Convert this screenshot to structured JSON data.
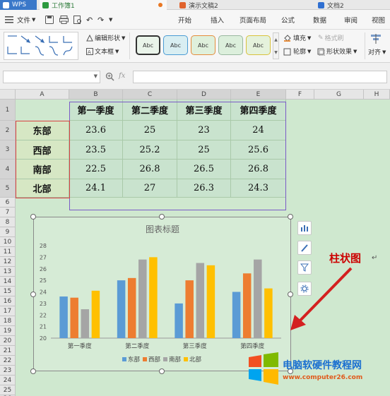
{
  "tabs": [
    {
      "label": "WPS"
    },
    {
      "label": "工作簿1"
    },
    {
      "label": "演示文稿2"
    },
    {
      "label": "文档2"
    }
  ],
  "menu": {
    "file": "文件",
    "items": [
      "开始",
      "插入",
      "页面布局",
      "公式",
      "数据",
      "审阅",
      "视图"
    ]
  },
  "ribbon": {
    "edit_shape": "编辑形状",
    "text_box": "文本框",
    "style_label": "Abc",
    "fill": "填充",
    "format_brush": "格式刷",
    "outline": "轮廓",
    "shape_effect": "形状效果",
    "align": "对齐"
  },
  "formula_bar": {
    "fx": "fx"
  },
  "columns": [
    "A",
    "B",
    "C",
    "D",
    "E",
    "F",
    "G",
    "H"
  ],
  "rows": [
    "1",
    "2",
    "3",
    "4",
    "5",
    "6",
    "7",
    "8",
    "9",
    "10",
    "11",
    "12",
    "13",
    "14",
    "15",
    "16",
    "17",
    "18",
    "19",
    "20",
    "21",
    "22",
    "23",
    "24",
    "25",
    "26"
  ],
  "table": {
    "headers": [
      "第一季度",
      "第二季度",
      "第三季度",
      "第四季度"
    ],
    "rows": [
      {
        "region": "东部",
        "values": [
          "23.6",
          "25",
          "23",
          "24"
        ]
      },
      {
        "region": "西部",
        "values": [
          "23.5",
          "25.2",
          "25",
          "25.6"
        ]
      },
      {
        "region": "南部",
        "values": [
          "22.5",
          "26.8",
          "26.5",
          "26.8"
        ]
      },
      {
        "region": "北部",
        "values": [
          "24.1",
          "27",
          "26.3",
          "24.3"
        ]
      }
    ]
  },
  "annotation": {
    "text": "柱状图",
    "color": "#cc0000"
  },
  "watermark": {
    "title": "电脑软硬件教程网",
    "url": "www.computer26.com"
  },
  "chart_data": {
    "type": "bar",
    "title": "图表标题",
    "categories": [
      "第一季度",
      "第二季度",
      "第三季度",
      "第四季度"
    ],
    "series": [
      {
        "name": "东部",
        "color": "#5b9bd5",
        "values": [
          23.6,
          25,
          23,
          24
        ]
      },
      {
        "name": "西部",
        "color": "#ed7d31",
        "values": [
          23.5,
          25.2,
          25,
          25.6
        ]
      },
      {
        "name": "南部",
        "color": "#a5a5a5",
        "values": [
          22.5,
          26.8,
          26.5,
          26.8
        ]
      },
      {
        "name": "北部",
        "color": "#ffc000",
        "values": [
          24.1,
          27,
          26.3,
          24.3
        ]
      }
    ],
    "ylim": [
      20,
      28
    ],
    "yticks": [
      20,
      21,
      22,
      23,
      24,
      25,
      26,
      27,
      28
    ],
    "grid": false,
    "legend": "bottom"
  },
  "colors": {
    "accent_green": "#2d7b3a",
    "header_fill": "#c9e3ce",
    "region_fill": "#d6e7c4",
    "selection_purple": "#7a5bc7"
  }
}
